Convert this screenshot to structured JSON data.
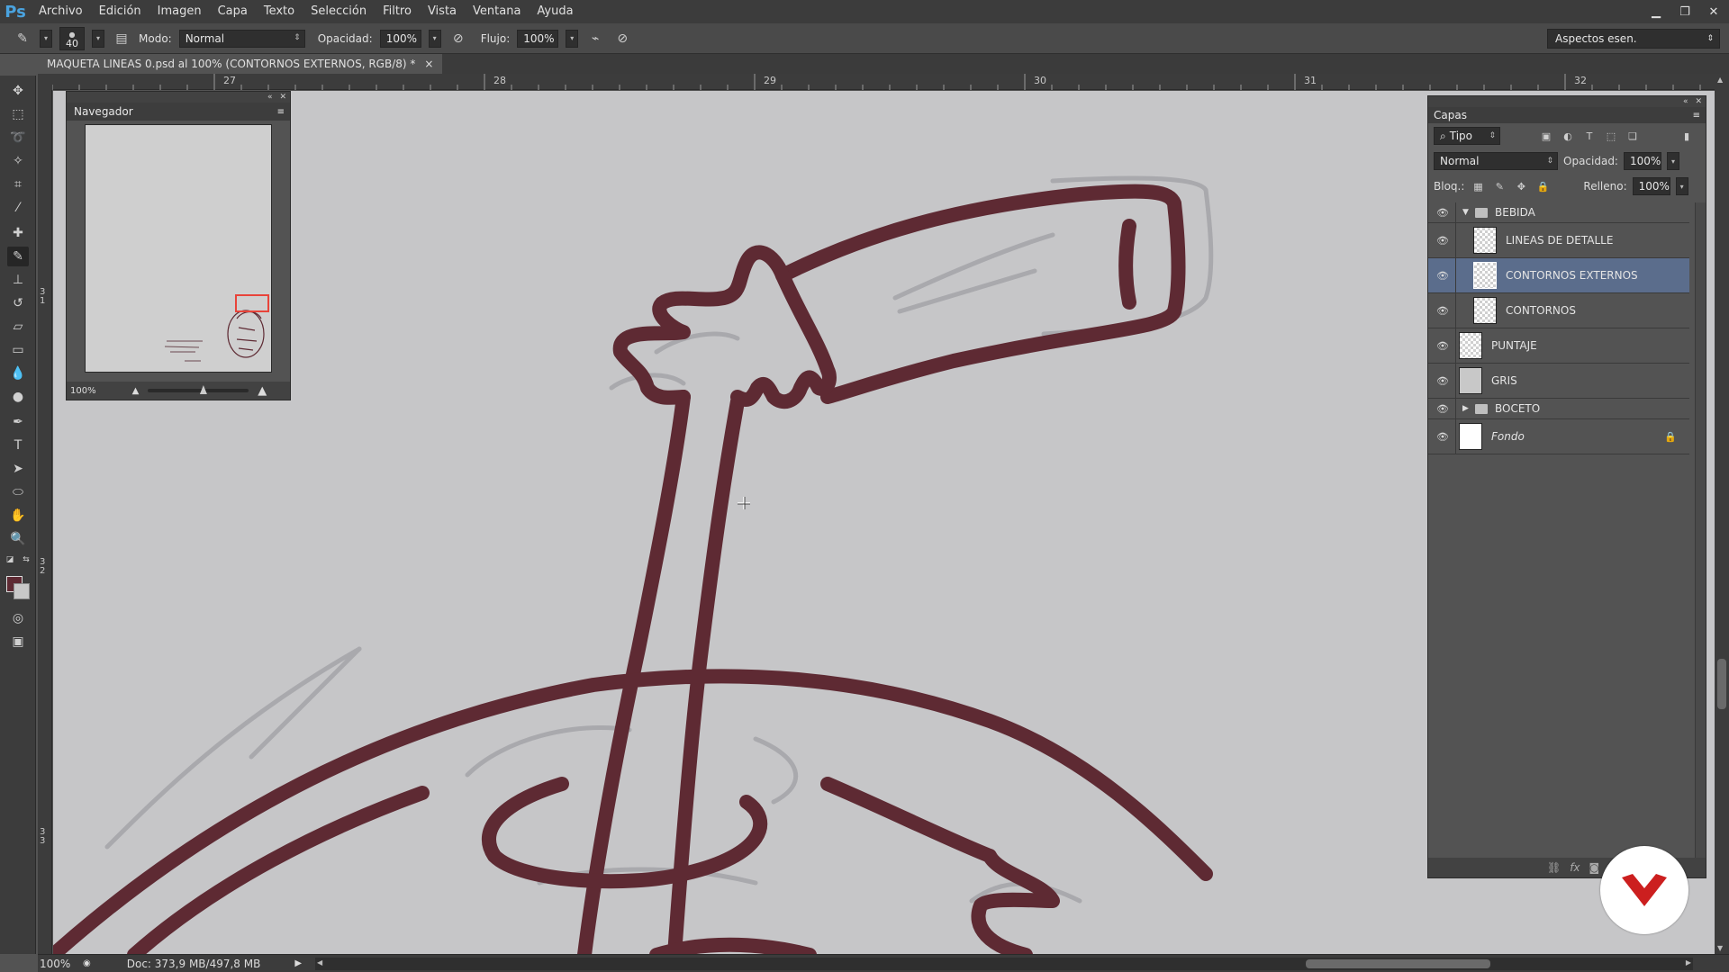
{
  "app": {
    "logo": "Ps",
    "menu": [
      "Archivo",
      "Edición",
      "Imagen",
      "Capa",
      "Texto",
      "Selección",
      "Filtro",
      "Vista",
      "Ventana",
      "Ayuda"
    ],
    "window_controls": [
      "minimize-icon",
      "restore-icon",
      "close-icon"
    ]
  },
  "options_bar": {
    "brush_size": "40",
    "mode_label": "Modo:",
    "mode_value": "Normal",
    "opacity_label": "Opacidad:",
    "opacity_value": "100%",
    "flow_label": "Flujo:",
    "flow_value": "100%",
    "workspace": "Aspectos esen."
  },
  "document": {
    "tab_title": "MAQUETA LINEAS 0.psd al 100% (CONTORNOS EXTERNOS, RGB/8) *",
    "tab_close": "×",
    "ruler_top": [
      "27",
      "28",
      "29",
      "30",
      "31",
      "32"
    ],
    "ruler_left": [
      [
        "3",
        "1"
      ],
      [
        "3",
        "2"
      ],
      [
        "3",
        "3"
      ]
    ]
  },
  "navigator": {
    "title": "Navegador",
    "zoom": "100%",
    "slider_position": 0.55
  },
  "layers_panel": {
    "title": "Capas",
    "filter_kind": "Tipo",
    "blend_mode": "Normal",
    "opacity_label": "Opacidad:",
    "opacity_value": "100%",
    "lock_label": "Bloq.:",
    "fill_label": "Relleno:",
    "fill_value": "100%",
    "layers": [
      {
        "name": "BEBIDA",
        "type": "group",
        "expanded": true,
        "indent": 0
      },
      {
        "name": "LINEAS DE DETALLE",
        "type": "layer",
        "indent": 1,
        "thumb": "transparent"
      },
      {
        "name": "CONTORNOS EXTERNOS",
        "type": "layer",
        "indent": 1,
        "thumb": "transparent",
        "selected": true
      },
      {
        "name": "CONTORNOS",
        "type": "layer",
        "indent": 1,
        "thumb": "transparent"
      },
      {
        "name": "PUNTAJE",
        "type": "layer",
        "indent": 0,
        "thumb": "transparent"
      },
      {
        "name": "GRIS",
        "type": "layer",
        "indent": 0,
        "thumb": "gray"
      },
      {
        "name": "BOCETO",
        "type": "group",
        "expanded": false,
        "indent": 0
      },
      {
        "name": "Fondo",
        "type": "background",
        "indent": 0,
        "thumb": "white",
        "locked": true
      }
    ],
    "footer_icons": [
      "link-icon",
      "fx-icon",
      "mask-icon",
      "adjustment-icon",
      "folder-icon",
      "new-layer-icon",
      "trash-icon"
    ]
  },
  "status_bar": {
    "zoom": "100%",
    "doc_info": "Doc: 373,9 MB/497,8 MB"
  },
  "colors": {
    "foreground": "#5e2a33",
    "background": "#c8c8c8",
    "stroke": "#5e2a33",
    "brand": "#cc1f1f"
  }
}
